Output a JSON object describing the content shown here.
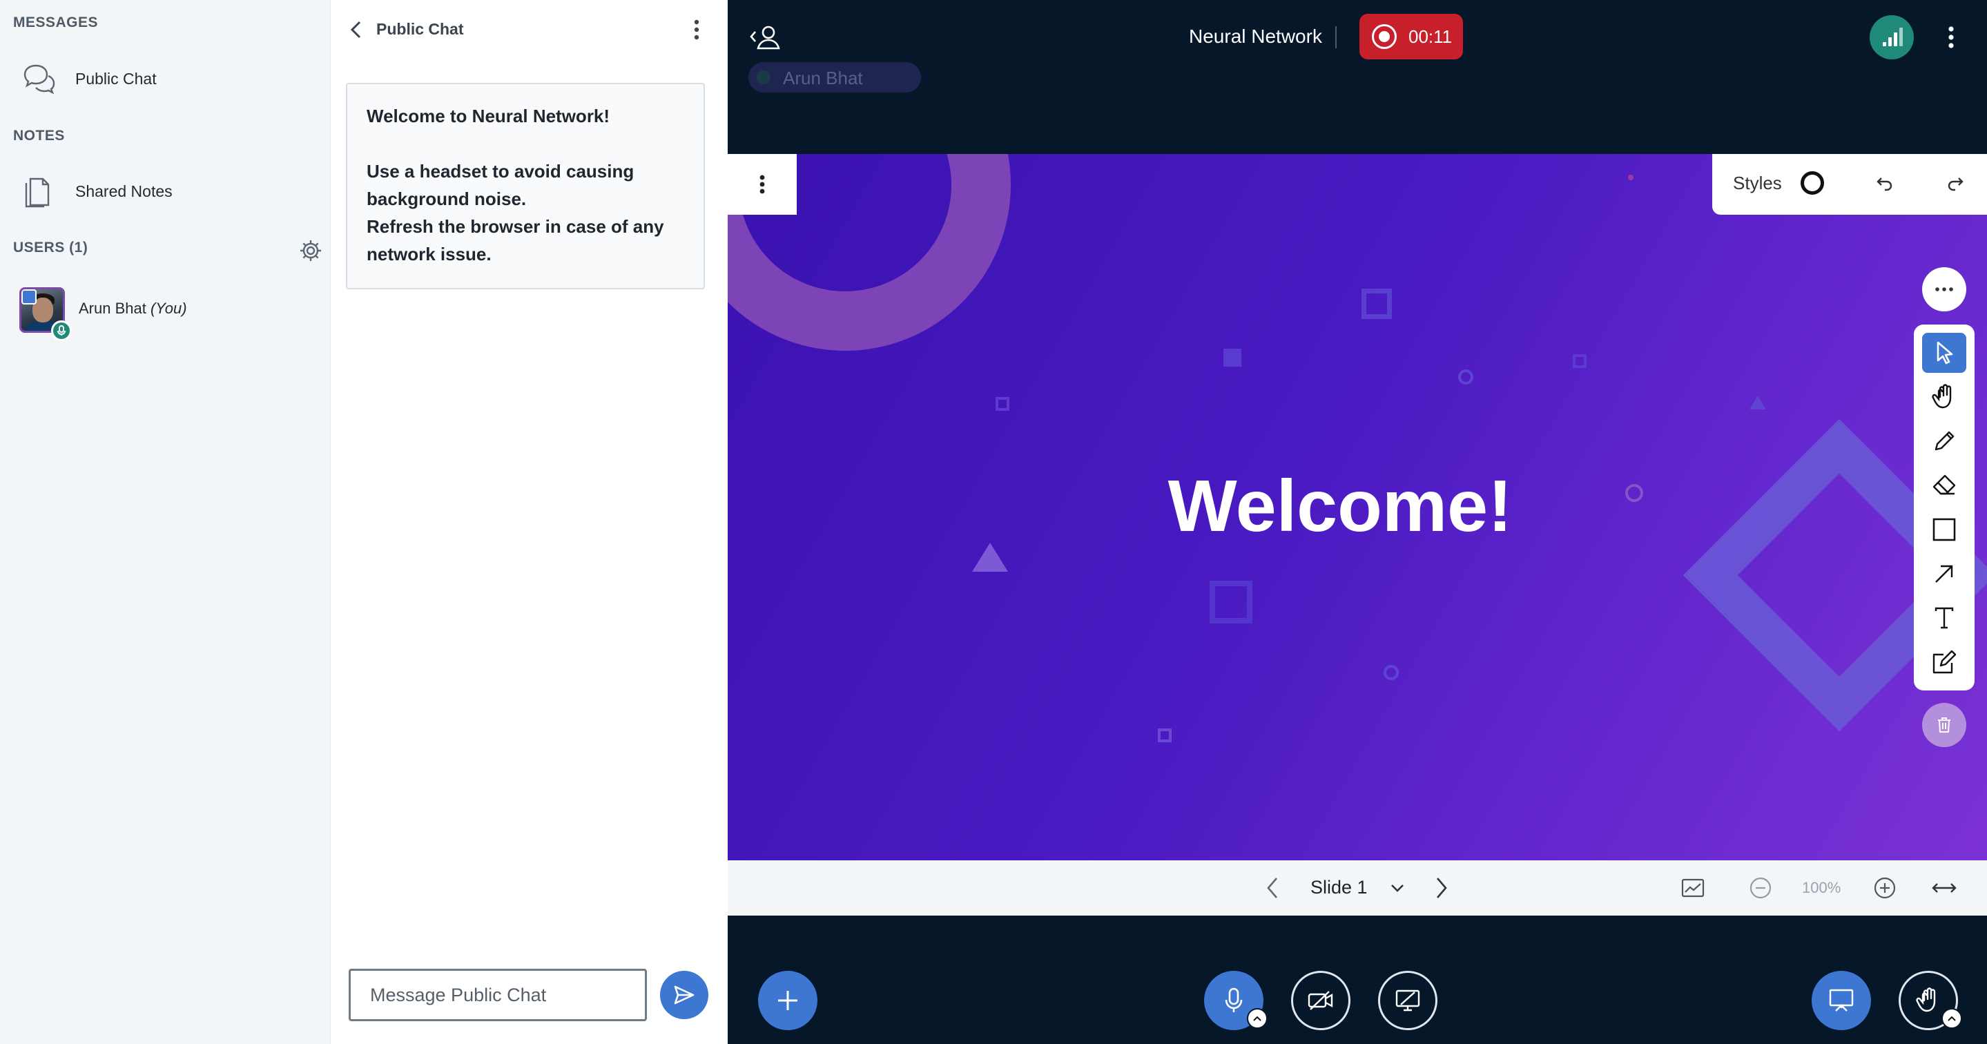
{
  "sidebar": {
    "messages_heading": "MESSAGES",
    "public_chat_label": "Public Chat",
    "notes_heading": "NOTES",
    "shared_notes_label": "Shared Notes",
    "users_heading": "USERS (1)",
    "user": {
      "name": "Arun Bhat",
      "suffix": "(You)"
    }
  },
  "chat": {
    "title": "Public Chat",
    "welcome": {
      "line1_prefix": "Welcome to ",
      "line1_name": "Neural Network",
      "line1_suffix": "!",
      "line2": "Use a headset to avoid causing background noise.",
      "line3": "Refresh the browser in case of any network issue."
    },
    "input_placeholder": "Message Public Chat"
  },
  "header": {
    "meeting_title": "Neural Network",
    "recording_time": "00:11",
    "talker_name": "Arun Bhat"
  },
  "slide": {
    "title": "Welcome!",
    "styles_label": "Styles"
  },
  "slide_nav": {
    "current_slide": "Slide 1",
    "zoom": "100%"
  },
  "colors": {
    "accent": "#3d77d1",
    "recording": "#c8202a",
    "status": "#1f8a7a",
    "background": "#06172a"
  },
  "icons": {
    "tools": [
      "select-icon",
      "hand-icon",
      "pencil-icon",
      "eraser-icon",
      "rectangle-icon",
      "arrow-icon",
      "text-icon",
      "note-icon"
    ]
  }
}
